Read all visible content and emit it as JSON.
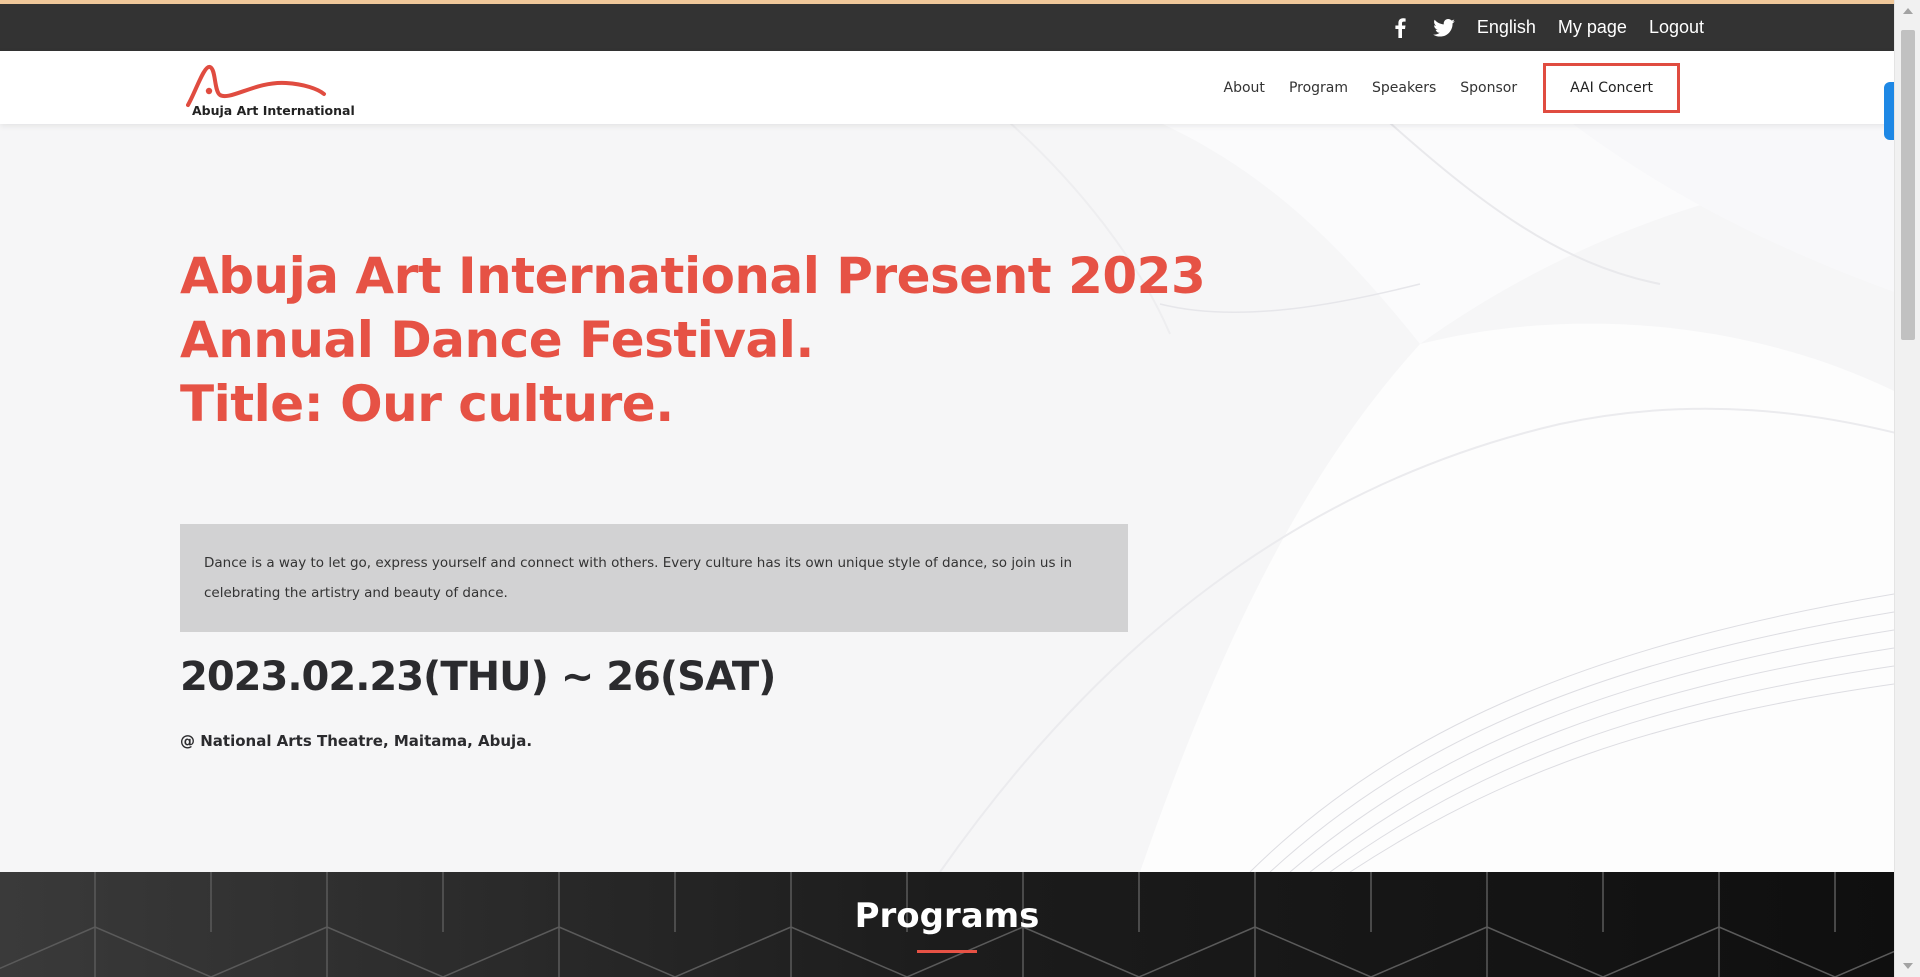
{
  "topbar": {
    "icons": [
      "facebook-icon",
      "twitter-icon"
    ],
    "language": "English",
    "my_page": "My page",
    "logout": "Logout"
  },
  "navbar": {
    "logo_text": "Abuja Art International",
    "links": [
      "About",
      "Program",
      "Speakers",
      "Sponsor"
    ],
    "cta": "AAI Concert"
  },
  "hero": {
    "title_line1": "Abuja Art International Present 2023 Annual Dance Festival.",
    "title_line2": "Title: Our culture.",
    "description": "Dance is a way to let go, express yourself and connect with others. Every culture has its own unique style of dance, so join us in celebrating the artistry and beauty of dance.",
    "dates": "2023.02.23(THU) ~ 26(SAT)",
    "venue": "@ National Arts Theatre, Maitama, Abuja."
  },
  "programs": {
    "title": "Programs"
  },
  "colors": {
    "accent": "#e65245",
    "topbar": "#333333",
    "programs_bg": "#1a1a1a"
  }
}
